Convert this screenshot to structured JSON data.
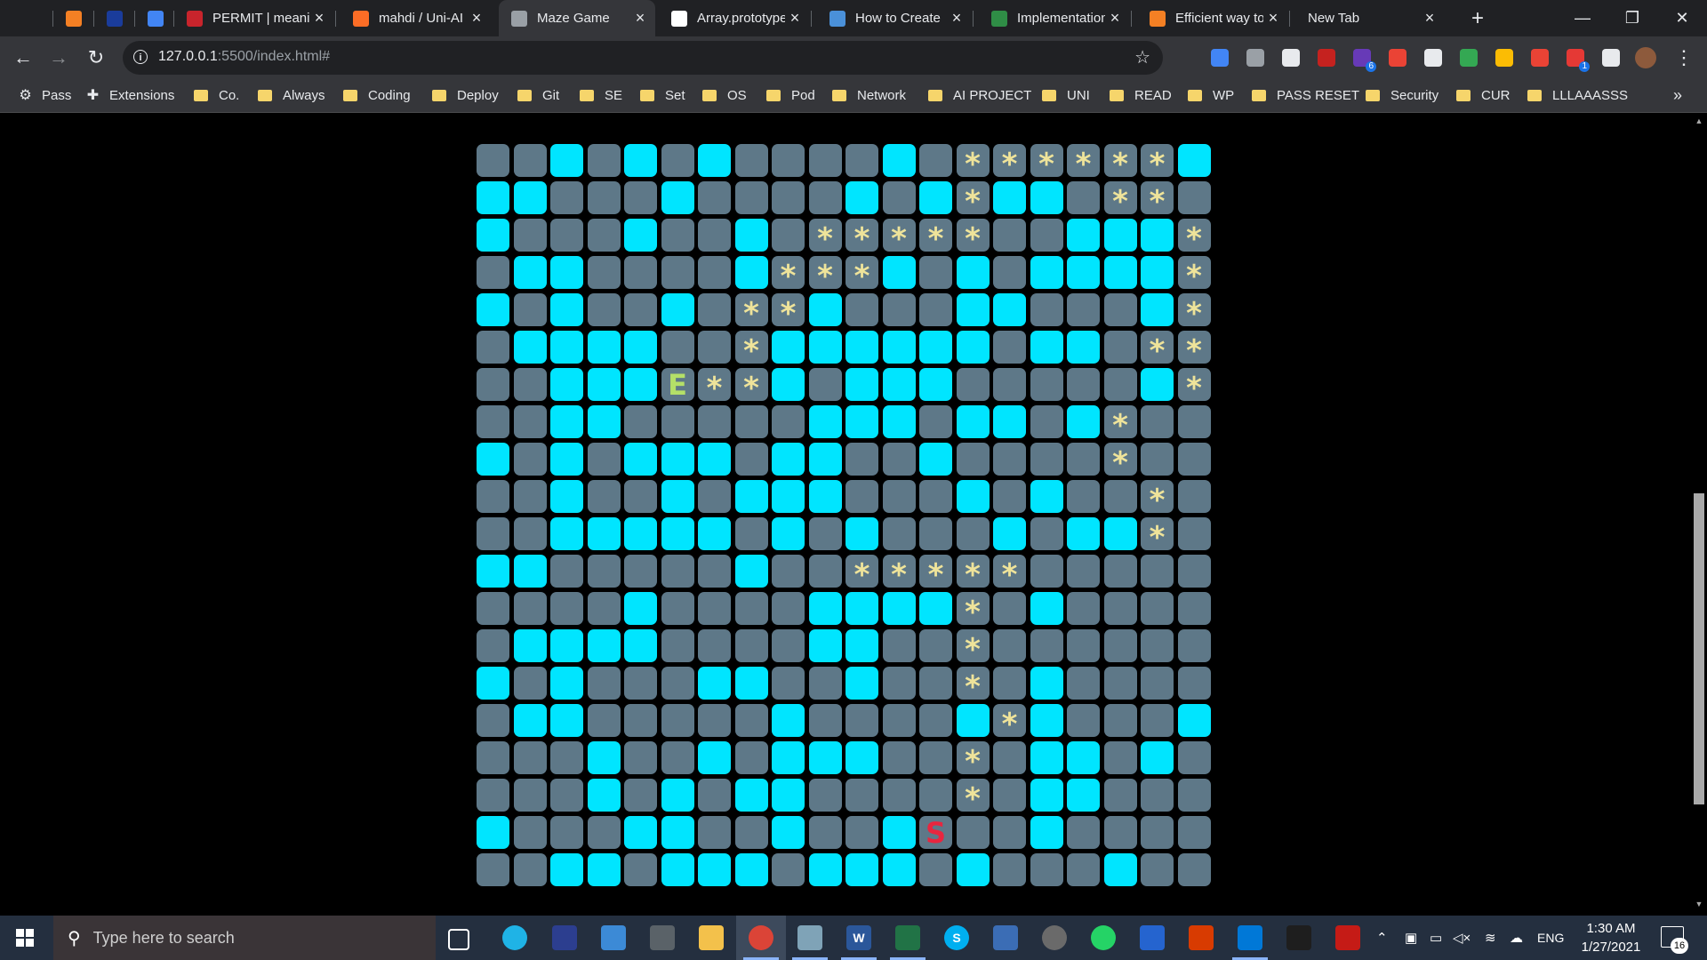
{
  "browser": {
    "tabs": [
      {
        "title": "",
        "favicon": "app-logo-icon",
        "color": "#202124"
      },
      {
        "title": "",
        "favicon": "stackoverflow-icon",
        "color": "#f48024"
      },
      {
        "title": "",
        "favicon": "globe-icon",
        "color": "#1a3c9b"
      },
      {
        "title": "",
        "favicon": "docs-icon",
        "color": "#4285f4"
      },
      {
        "title": "PERMIT | meaning",
        "favicon": "dictionary-icon",
        "color": "#c8242c"
      },
      {
        "title": "mahdi / Uni-AI",
        "favicon": "gitlab-icon",
        "color": "#fc6d26"
      },
      {
        "title": "Maze Game",
        "favicon": "globe-icon",
        "color": "#9aa0a6"
      },
      {
        "title": "Array.prototype",
        "favicon": "mdn-icon",
        "color": "#ffffff"
      },
      {
        "title": "How to Create",
        "favicon": "site-icon",
        "color": "#4a90d9"
      },
      {
        "title": "Implementation",
        "favicon": "gfg-icon",
        "color": "#2f8d46"
      },
      {
        "title": "Efficient way to",
        "favicon": "stackoverflow-icon",
        "color": "#f48024"
      },
      {
        "title": "New Tab",
        "favicon": "",
        "color": ""
      }
    ],
    "new_tab_symbol": "+",
    "window_controls": {
      "minimize": "—",
      "restore": "❐",
      "close": "✕"
    },
    "url_main": "127.0.0.1",
    "url_rest": ":5500/index.html#",
    "bookmarks": [
      {
        "label": "Pass",
        "kind": "icon",
        "icon": "gear-icon"
      },
      {
        "label": "Extensions",
        "kind": "icon",
        "icon": "puzzle-icon"
      },
      {
        "label": "Co.",
        "kind": "folder"
      },
      {
        "label": "Always",
        "kind": "folder"
      },
      {
        "label": "Coding",
        "kind": "folder"
      },
      {
        "label": "Deploy",
        "kind": "folder"
      },
      {
        "label": "Git",
        "kind": "folder"
      },
      {
        "label": "SE",
        "kind": "folder"
      },
      {
        "label": "Set",
        "kind": "folder"
      },
      {
        "label": "OS",
        "kind": "folder"
      },
      {
        "label": "Pod",
        "kind": "folder"
      },
      {
        "label": "Network",
        "kind": "folder"
      },
      {
        "label": "AI PROJECT",
        "kind": "folder"
      },
      {
        "label": "UNI",
        "kind": "folder"
      },
      {
        "label": "READ",
        "kind": "folder"
      },
      {
        "label": "WP",
        "kind": "folder"
      },
      {
        "label": "PASS RESET",
        "kind": "folder"
      },
      {
        "label": "Security",
        "kind": "folder"
      },
      {
        "label": "CUR",
        "kind": "folder"
      },
      {
        "label": "LLLAAASSS",
        "kind": "folder"
      }
    ],
    "bookmarks_overflow": "»",
    "extension_badges": {
      "ext-3": "6",
      "ext-9": "1"
    }
  },
  "maze": {
    "legend": {
      "wall": "#5e7888",
      "open": "#00e5ff",
      "path": "#eee39a",
      "start": "#e8263f",
      "end": "#b4e068"
    },
    "path_symbol": "*",
    "start_symbol": "S",
    "end_symbol": "E",
    "rows": [
      "##O#O#O####O#PPPPPPO",
      "OO###O####O#OPOO#PP",
      "O###O##O#PPPPP##OOOP",
      "#OO####OPPPO#O#OOOOP",
      "O#O##O#PPO###OO###OP",
      "#OOOO##POOOOOO#OO#PP",
      "##OOOEPPO#OOO#####OP#",
      "##OO#####OOO#OO#OP#",
      "O#O#OOO#OO##O####P#",
      "##O##O#OOO###O#O##P#",
      "##OOOOO#O#O###O#OOP#",
      "OO#####O##PPPPP#",
      "####O####OOOOP#O###",
      "#OOOO####OO##P#####",
      "O#O###OO##O##P#O###",
      "#OO#####O####OPO###O",
      "###O##O#OOO##P#OO#O",
      "###O#O#OO####P#OO##",
      "O###OO##O##OS##O##",
      "##OO#OOO#OOO#O###O#"
    ]
  },
  "taskbar": {
    "search_placeholder": "Type here to search",
    "apps": [
      "task-view-icon",
      "edge-icon",
      "app-icon",
      "mail-icon",
      "calculator-icon",
      "file-explorer-icon",
      "chrome-icon",
      "notes-icon",
      "word-icon",
      "excel-icon",
      "skype-icon",
      "network-tool-icon",
      "media-icon",
      "whatsapp-icon",
      "todo-icon",
      "office-icon",
      "vscode-icon",
      "terminal-icon",
      "acrobat-icon"
    ],
    "word_label": "W",
    "skype_label": "S",
    "language": "ENG",
    "time": "1:30 AM",
    "date": "1/27/2021",
    "notification_count": "16"
  }
}
